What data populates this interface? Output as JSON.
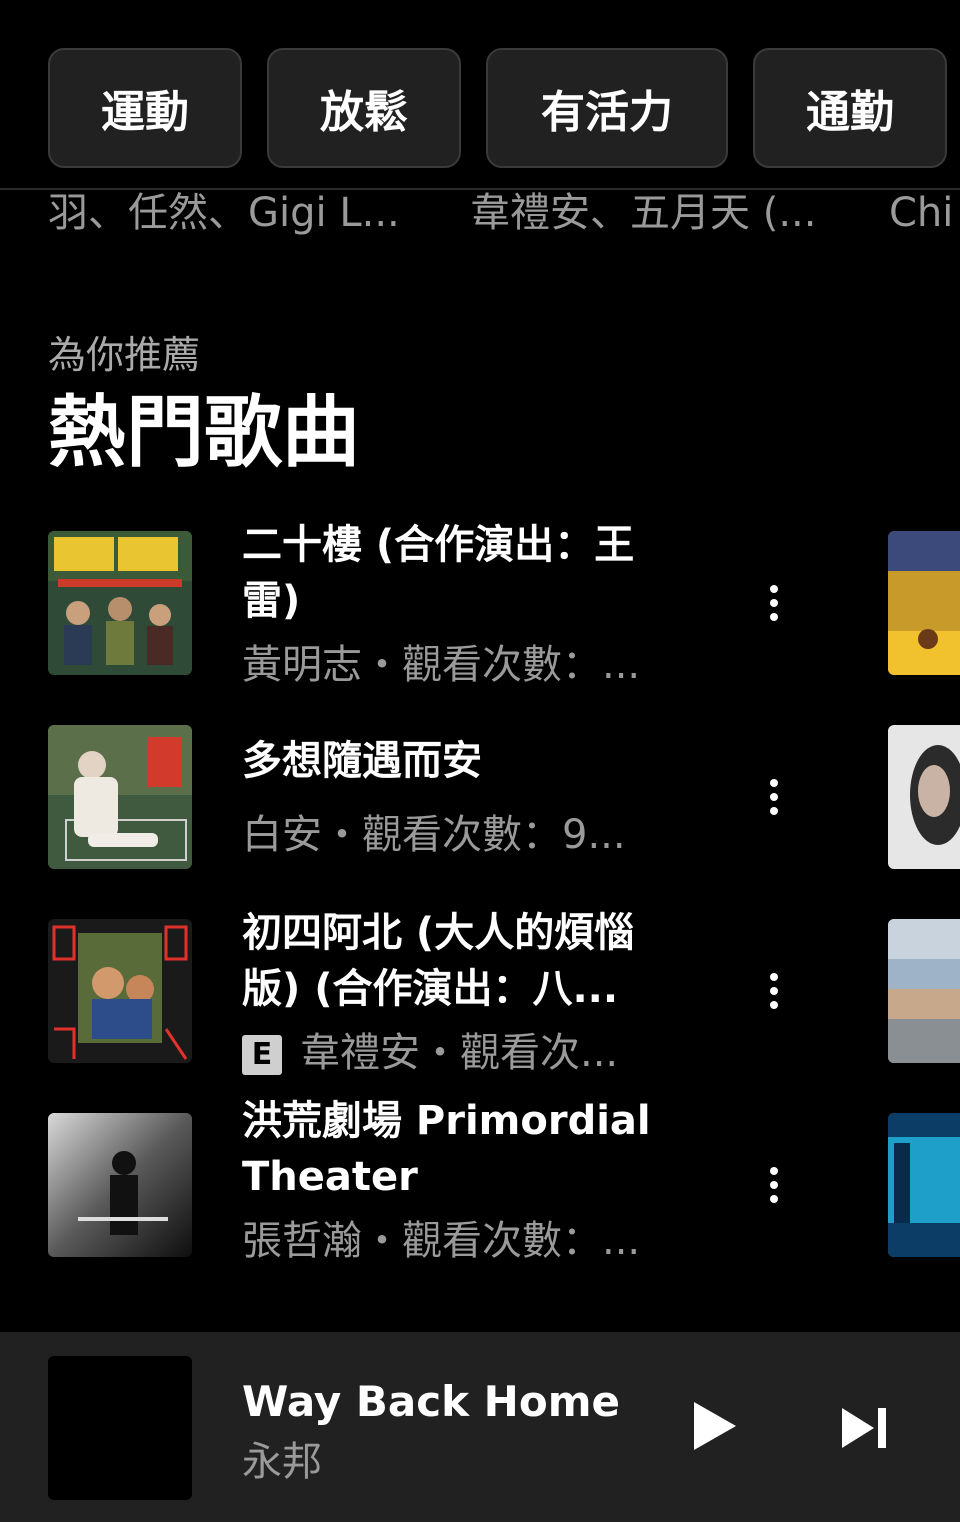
{
  "chips": [
    "運動",
    "放鬆",
    "有活力",
    "通勤"
  ],
  "previous_shelf": {
    "subtitles": [
      "羽、任然、Gigi L...",
      "韋禮安、五月天 (...",
      "Chi"
    ]
  },
  "section": {
    "overline": "為你推薦",
    "title": "熱門歌曲"
  },
  "songs": [
    {
      "title": "二十樓 (合作演出：王雷)",
      "subtitle": "黃明志・觀看次數：...",
      "explicit": false
    },
    {
      "title": "多想隨遇而安",
      "subtitle": "白安・觀看次數：9...",
      "explicit": false
    },
    {
      "title": "初四阿北 (大人的煩惱版) (合作演出：八...",
      "subtitle": "韋禮安・觀看次...",
      "explicit": true,
      "explicit_badge": "E"
    },
    {
      "title": "洪荒劇場 Primordial Theater",
      "subtitle": "張哲瀚・觀看次數：...",
      "explicit": false
    }
  ],
  "now_playing": {
    "title": "Way Back Home",
    "artist": "永邦"
  },
  "icons": {
    "more": "more-vert-icon",
    "play": "play-icon",
    "next": "skip-next-icon"
  }
}
